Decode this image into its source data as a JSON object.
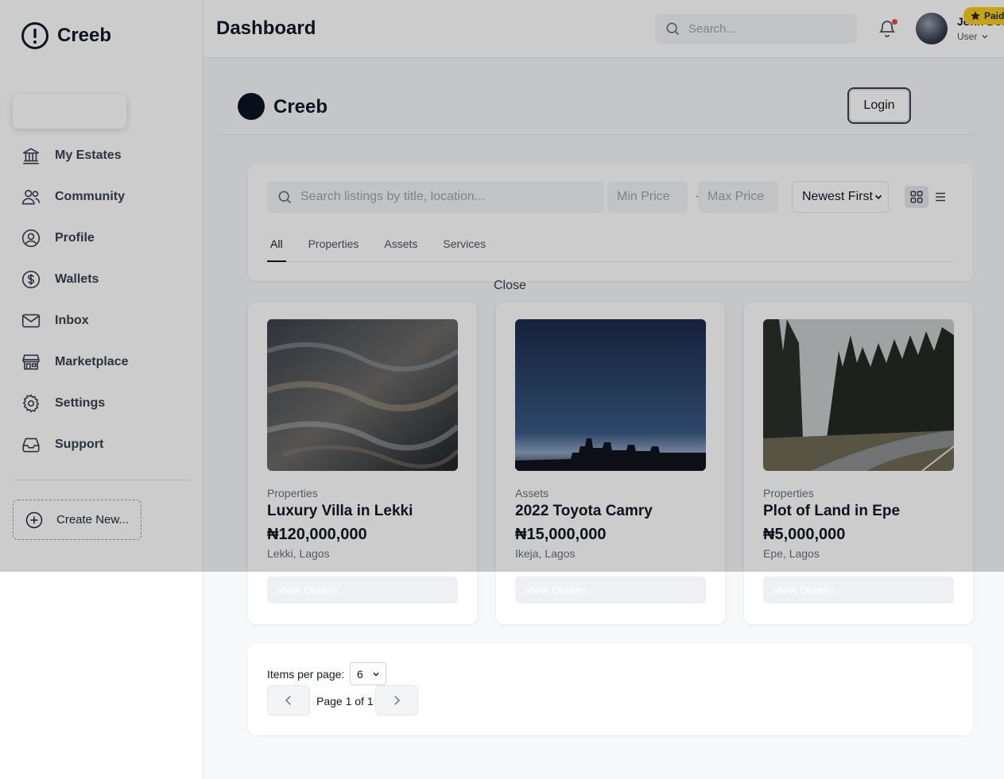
{
  "brand": {
    "name": "Creeb",
    "icon": "alert-circle-icon"
  },
  "sidebar": {
    "items": [
      {
        "label": "My Estates",
        "icon": "bank-icon"
      },
      {
        "label": "Community",
        "icon": "users-icon"
      },
      {
        "label": "Profile",
        "icon": "user-circle-icon"
      },
      {
        "label": "Wallets",
        "icon": "dollar-icon"
      },
      {
        "label": "Inbox",
        "icon": "mail-icon"
      },
      {
        "label": "Marketplace",
        "icon": "store-icon"
      },
      {
        "label": "Settings",
        "icon": "gear-icon"
      },
      {
        "label": "Support",
        "icon": "inbox-tray-icon"
      }
    ],
    "create_label": "Create New..."
  },
  "header": {
    "title": "Dashboard",
    "search_placeholder": "Search...",
    "user_name": "John Doe",
    "user_role": "User",
    "badge": "Paid"
  },
  "marketplace": {
    "name": "Creeb",
    "login_label": "Login",
    "search_placeholder": "Search listings by title, location...",
    "min_price_placeholder": "Min Price",
    "max_price_placeholder": "Max Price",
    "price_separator": "-",
    "sort_value": "Newest First",
    "tabs": [
      "All",
      "Properties",
      "Assets",
      "Services"
    ],
    "close_label": "Close"
  },
  "listings": [
    {
      "category": "Properties",
      "title": "Luxury Villa in Lekki",
      "price": "₦120,000,000",
      "location": "Lekki, Lagos",
      "button": "View Details"
    },
    {
      "category": "Assets",
      "title": "2022 Toyota Camry",
      "price": "₦15,000,000",
      "location": "Ikeja, Lagos",
      "button": "View Details"
    },
    {
      "category": "Properties",
      "title": "Plot of Land in Epe",
      "price": "₦5,000,000",
      "location": "Epe, Lagos",
      "button": "View Details"
    }
  ],
  "pagination": {
    "items_per_page_label": "Items per page:",
    "items_per_page_value": "6",
    "page_text": "Page 1 of 1"
  }
}
